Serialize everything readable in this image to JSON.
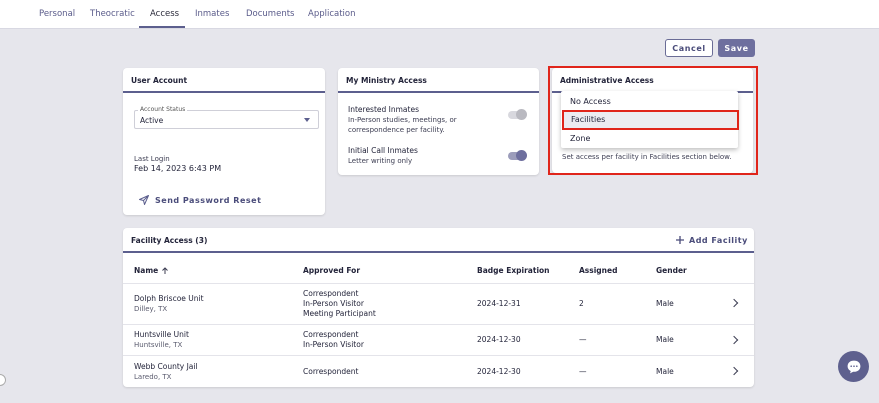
{
  "tabs": [
    {
      "label": "Personal"
    },
    {
      "label": "Theocratic"
    },
    {
      "label": "Access"
    },
    {
      "label": "Inmates"
    },
    {
      "label": "Documents"
    },
    {
      "label": "Application"
    }
  ],
  "toolbar": {
    "cancel_label": "Cancel",
    "save_label": "Save"
  },
  "user_account": {
    "title": "User Account",
    "status_legend": "Account Status",
    "status_value": "Active",
    "last_login_label": "Last Login",
    "last_login_value": "Feb 14, 2023 6:43 PM",
    "reset_label": "Send Password Reset"
  },
  "ministry": {
    "title": "My Ministry Access",
    "interested_title": "Interested Inmates",
    "interested_desc_1": "In-Person studies, meetings, or",
    "interested_desc_2": "correspondence per facility.",
    "interested_enabled": false,
    "initial_title": "Initial Call Inmates",
    "initial_desc": "Letter writing only",
    "initial_enabled": true
  },
  "admin": {
    "title": "Administrative Access",
    "options": [
      "No Access",
      "Facilities",
      "Zone"
    ],
    "selected": "Facilities",
    "hint": "Set access per facility in Facilities section below."
  },
  "facility": {
    "title": "Facility Access (3)",
    "add_label": "Add Facility",
    "columns": {
      "name": "Name",
      "approved": "Approved For",
      "badge": "Badge Expiration",
      "assigned": "Assigned",
      "gender": "Gender"
    },
    "rows": [
      {
        "name": "Dolph Briscoe Unit",
        "location": "Dilley, TX",
        "approved": [
          "Correspondent",
          "In-Person Visitor",
          "Meeting Participant"
        ],
        "badge": "2024-12-31",
        "assigned": "2",
        "gender": "Male"
      },
      {
        "name": "Huntsville Unit",
        "location": "Huntsville, TX",
        "approved": [
          "Correspondent",
          "In-Person Visitor"
        ],
        "badge": "2024-12-30",
        "assigned": "—",
        "gender": "Male"
      },
      {
        "name": "Webb County Jail",
        "location": "Laredo, TX",
        "approved": [
          "Correspondent"
        ],
        "badge": "2024-12-30",
        "assigned": "—",
        "gender": "Male"
      }
    ]
  },
  "icons": {
    "sort": "arrow-up-icon",
    "send": "send-icon",
    "add": "plus-icon",
    "chat": "chat-bubble-icon"
  },
  "colors": {
    "accent": "#5c5f8e",
    "highlight": "#e0251b",
    "background": "#e6e6ec"
  }
}
